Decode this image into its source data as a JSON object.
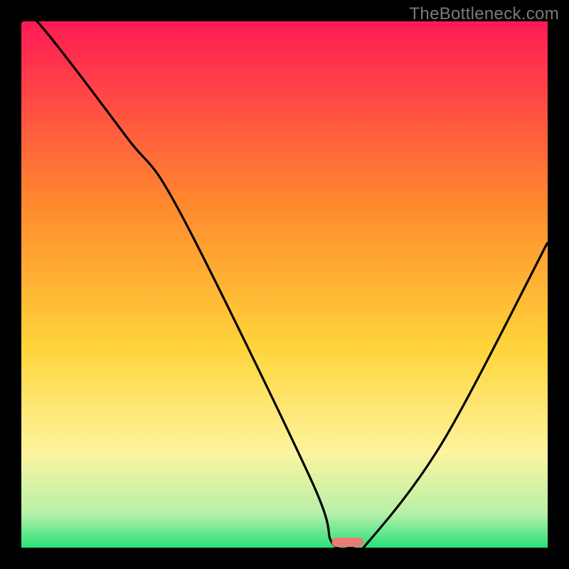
{
  "watermark": "TheBottleneck.com",
  "colors": {
    "top": "#ff1a55",
    "mid1": "#ff8a2e",
    "mid2": "#ffd43a",
    "yellow_pale": "#fdf49e",
    "green_light": "#b7f0a9",
    "green": "#28e07a",
    "marker": "#ea7a73",
    "frame": "#000000"
  },
  "chart_data": {
    "type": "line",
    "title": "",
    "xlabel": "",
    "ylabel": "",
    "xlim": [
      0,
      100
    ],
    "ylim": [
      0,
      100
    ],
    "x": [
      0,
      3,
      20,
      30,
      55,
      59,
      63,
      65,
      80,
      100
    ],
    "values": [
      100,
      100,
      78,
      64,
      13,
      1,
      0,
      0,
      20,
      58
    ],
    "marker": {
      "x_range": [
        59,
        65
      ],
      "y": 0
    },
    "legend": false,
    "grid": false
  }
}
